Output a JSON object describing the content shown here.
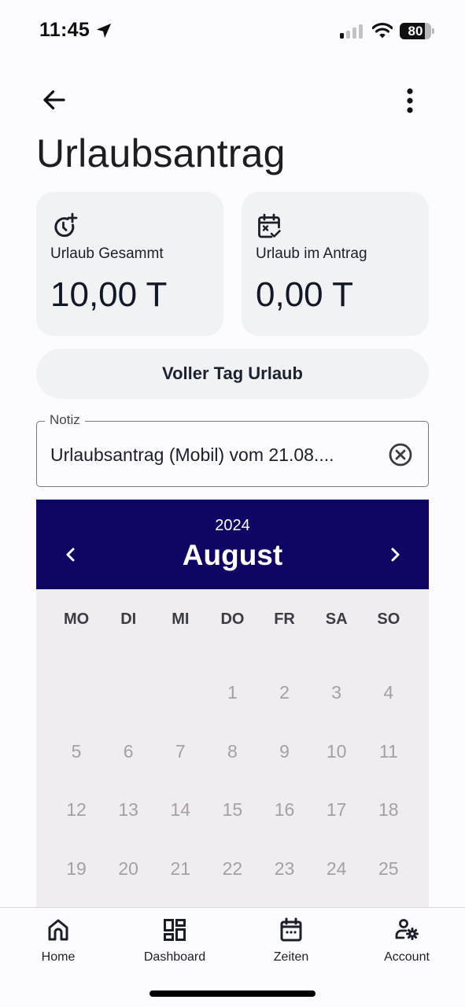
{
  "status_bar": {
    "time": "11:45",
    "battery_percent": 80,
    "battery_text": "80",
    "signal_bars_active": 1,
    "signal_bars_total": 4
  },
  "app_bar": {
    "back_icon": "arrow-left-icon",
    "menu_icon": "more-vertical-icon"
  },
  "page": {
    "title": "Urlaubsantrag"
  },
  "cards": [
    {
      "icon": "clock-plus-icon",
      "label": "Urlaub Gesammt",
      "value": "10,00 T"
    },
    {
      "icon": "calendar-x-check-icon",
      "label": "Urlaub im Antrag",
      "value": "0,00 T"
    }
  ],
  "full_day_button": {
    "label": "Voller Tag Urlaub"
  },
  "note": {
    "label": "Notiz",
    "value": "Urlaubsantrag (Mobil) vom 21.08....",
    "clear_icon": "clear-circle-icon"
  },
  "calendar": {
    "year": "2024",
    "month": "August",
    "weekdays": [
      "MO",
      "DI",
      "MI",
      "DO",
      "FR",
      "SA",
      "SO"
    ],
    "leading_blanks": 3,
    "visible_days": [
      "1",
      "2",
      "3",
      "4",
      "5",
      "6",
      "7",
      "8",
      "9",
      "10",
      "11",
      "12",
      "13",
      "14",
      "15",
      "16",
      "17",
      "18",
      "19",
      "20",
      "21",
      "22",
      "23",
      "24",
      "25"
    ],
    "colors": {
      "header_bg": "#0f0565",
      "body_bg": "#f1ecf0",
      "day_text": "#a4a0a6"
    }
  },
  "bottom_nav": {
    "items": [
      {
        "icon": "home-icon",
        "label": "Home"
      },
      {
        "icon": "dashboard-icon",
        "label": "Dashboard"
      },
      {
        "icon": "calendar-icon",
        "label": "Zeiten"
      },
      {
        "icon": "user-settings-icon",
        "label": "Account"
      }
    ]
  }
}
